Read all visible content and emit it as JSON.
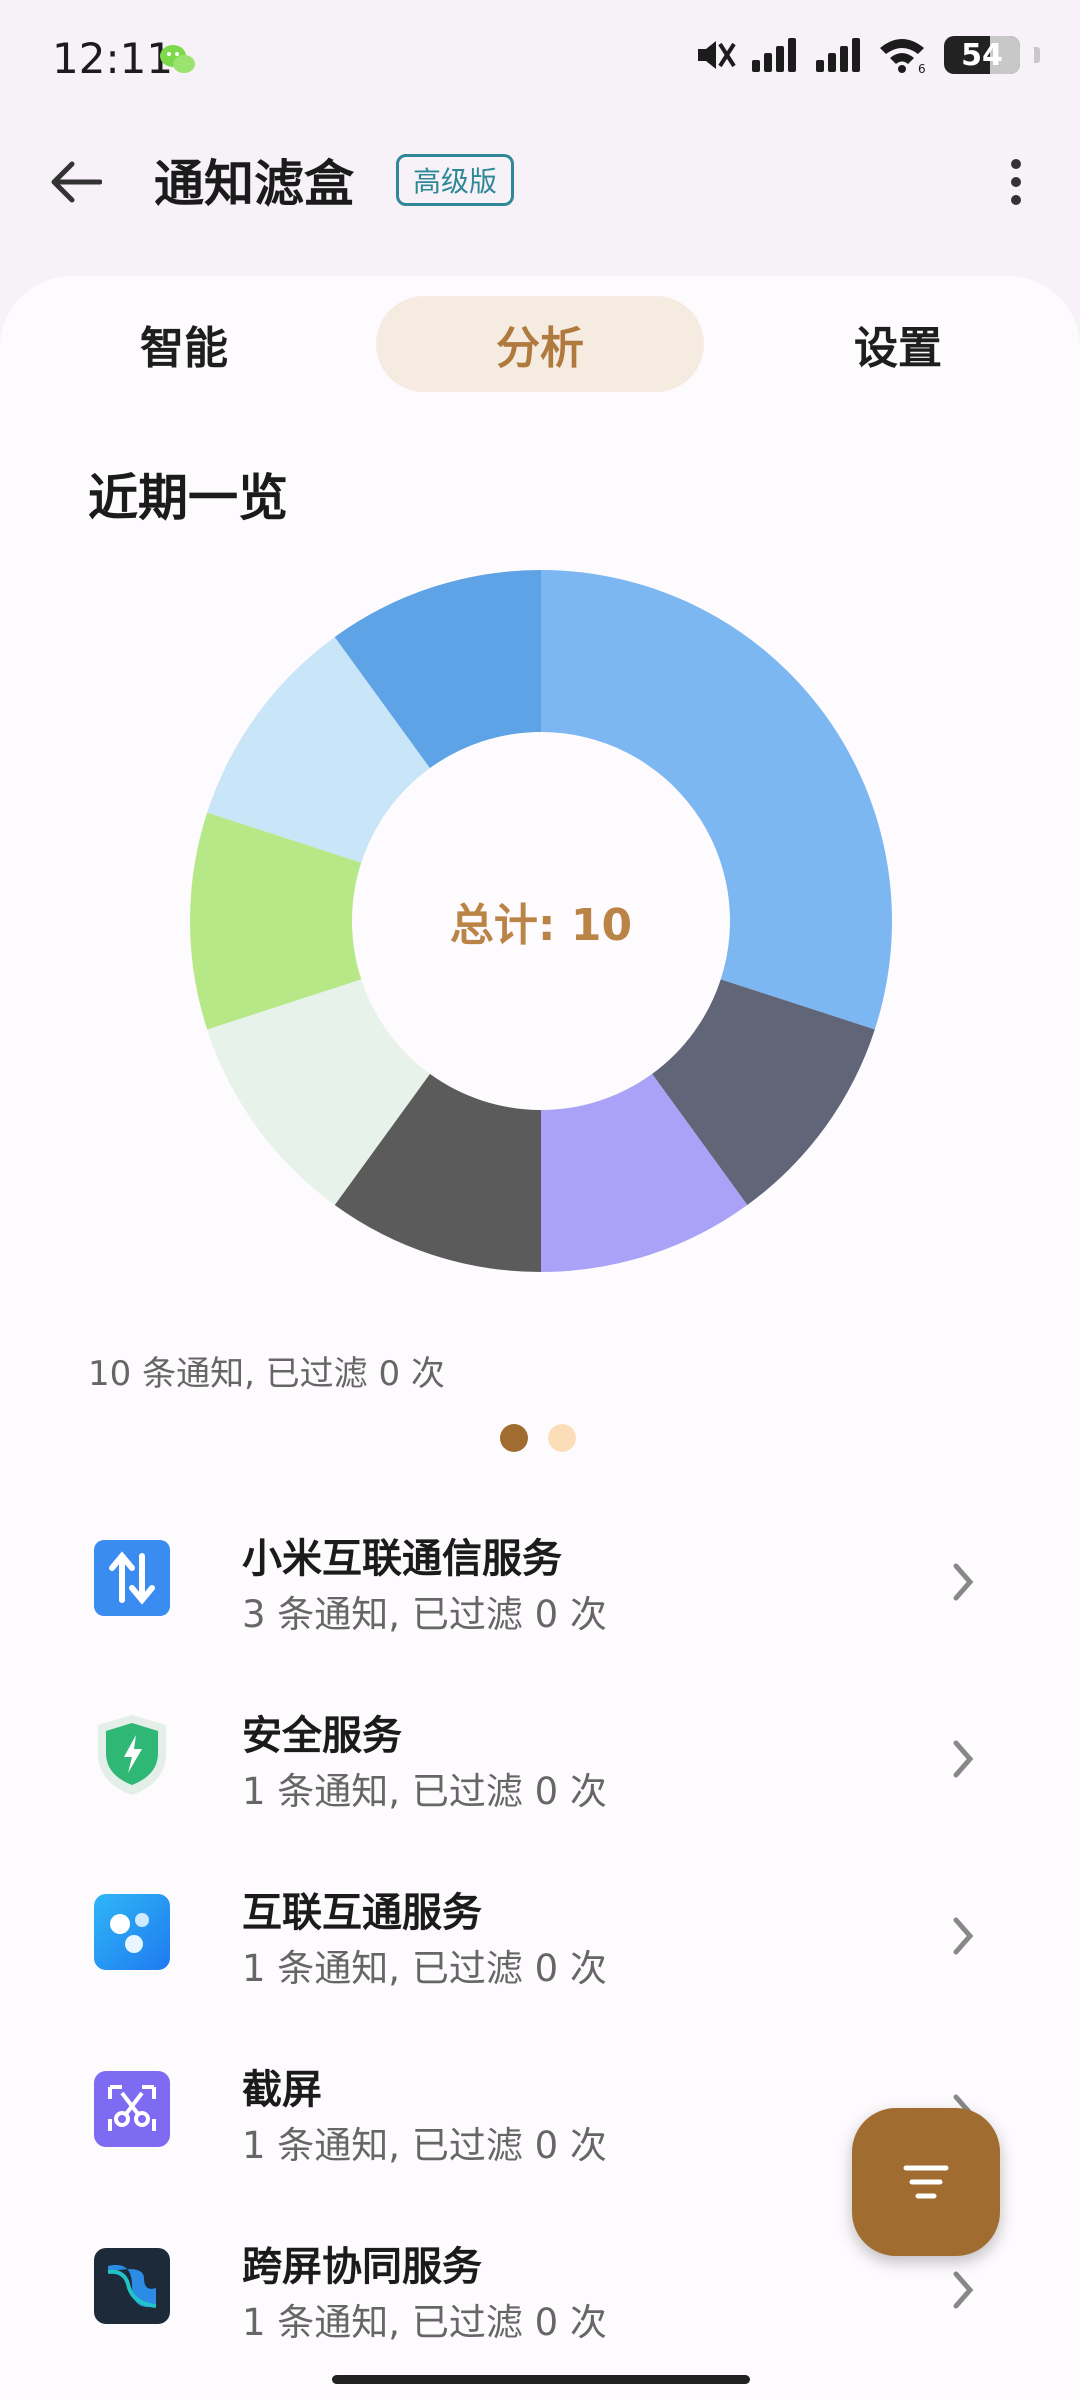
{
  "status_bar": {
    "time": "12:11",
    "battery": "54"
  },
  "app_bar": {
    "title": "通知滤盒",
    "badge": "高级版"
  },
  "tabs": [
    {
      "label": "智能",
      "selected": false
    },
    {
      "label": "分析",
      "selected": true
    },
    {
      "label": "设置",
      "selected": false
    }
  ],
  "overview": {
    "title": "近期一览",
    "center_label": "总计: 10",
    "summary": "10 条通知, 已过滤 0 次",
    "page_indicator": {
      "current": 1,
      "total": 2
    }
  },
  "chart_data": {
    "type": "pie",
    "donut": true,
    "total": 10,
    "slices": [
      {
        "value": 3,
        "color": "#7DB7F2"
      },
      {
        "value": 1,
        "color": "#606577"
      },
      {
        "value": 1,
        "color": "#A9A2F6"
      },
      {
        "value": 1,
        "color": "#5B5B5B"
      },
      {
        "value": 1,
        "color": "#E7F2EA"
      },
      {
        "value": 1,
        "color": "#B6E887"
      },
      {
        "value": 1,
        "color": "#C8E6F8"
      },
      {
        "value": 1,
        "color": "#5DA3E5"
      }
    ]
  },
  "apps": [
    {
      "name": "小米互联通信服务",
      "count": "3 条通知, 已过滤 0 次",
      "icon": "data-transfer-icon"
    },
    {
      "name": "安全服务",
      "count": "1 条通知, 已过滤 0 次",
      "icon": "security-shield-icon"
    },
    {
      "name": "互联互通服务",
      "count": "1 条通知, 已过滤 0 次",
      "icon": "interconnect-icon"
    },
    {
      "name": "截屏",
      "count": "1 条通知, 已过滤 0 次",
      "icon": "screenshot-icon"
    },
    {
      "name": "跨屏协同服务",
      "count": "1 条通知, 已过滤 0 次",
      "icon": "cross-screen-icon"
    }
  ],
  "colors": {
    "accent": "#A06C30",
    "tab_selected_bg": "#F5EBE0",
    "badge": "#2F8797"
  }
}
